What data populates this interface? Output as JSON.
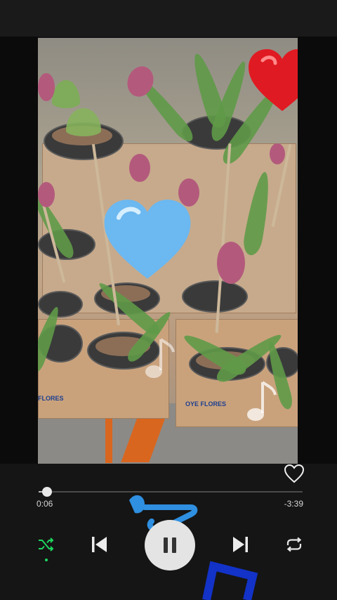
{
  "player": {
    "elapsed": "0:06",
    "remaining": "-3:39",
    "progress_fraction": 0.033,
    "liked": false
  },
  "controls": {
    "shuffle_icon": "shuffle-icon",
    "previous_icon": "skip-previous-icon",
    "play_pause_icon": "pause-icon",
    "next_icon": "skip-next-icon",
    "repeat_icon": "repeat-icon",
    "like_icon": "heart-outline-icon"
  },
  "video": {
    "crate_labels": [
      "OYE FLORES",
      "FLORES"
    ]
  },
  "colors": {
    "accent": "#1ed760",
    "red_heart": "#e01a22",
    "blue_heart": "#6cb8f0",
    "blue_note": "#2f8fe0"
  }
}
